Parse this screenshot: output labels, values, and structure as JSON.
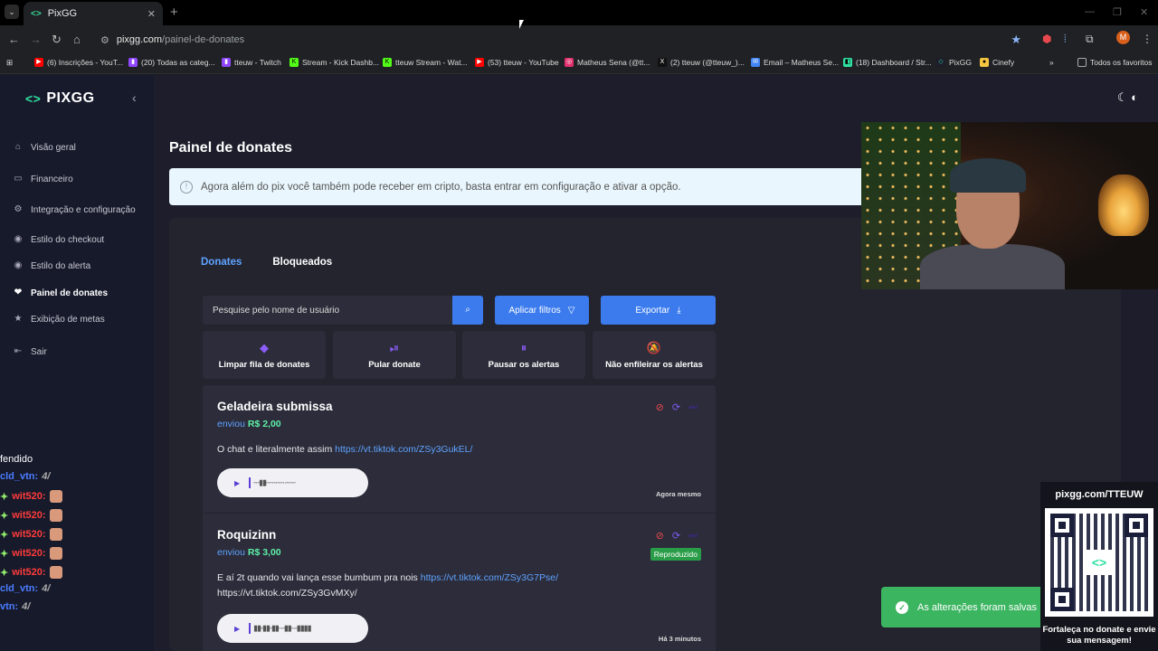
{
  "browser": {
    "tab_title": "PixGG",
    "tab_favicon": "<>",
    "url_host": "pixgg.com",
    "url_path": "/painel-de-donates",
    "bookmarks": [
      {
        "label": "(6) Inscrições - YouT...",
        "icon": "youtube-icon",
        "color": "#ff0000"
      },
      {
        "label": "(20) Todas as categ...",
        "icon": "twitch-icon",
        "color": "#9146ff"
      },
      {
        "label": "tteuw - Twitch",
        "icon": "twitch-icon",
        "color": "#9146ff"
      },
      {
        "label": "Stream - Kick Dashb...",
        "icon": "kick-icon",
        "color": "#53fc18"
      },
      {
        "label": "tteuw Stream - Wat...",
        "icon": "kick-icon",
        "color": "#53fc18"
      },
      {
        "label": "(53) tteuw - YouTube",
        "icon": "youtube-icon",
        "color": "#ff0000"
      },
      {
        "label": "Matheus Sena (@tt...",
        "icon": "instagram-icon",
        "color": "#e1306c"
      },
      {
        "label": "(2) tteuw (@tteuw_)...",
        "icon": "x-icon",
        "color": "#000000"
      },
      {
        "label": "Email – Matheus Se...",
        "icon": "email-icon",
        "color": "#4285f4"
      },
      {
        "label": "(18) Dashboard / Str...",
        "icon": "dashboard-icon",
        "color": "#2fe0a0"
      },
      {
        "label": "PixGG",
        "icon": "pixgg-icon",
        "color": "#2fe0a0"
      },
      {
        "label": "Cinefy",
        "icon": "cinefy-icon",
        "color": "#f5c542"
      }
    ],
    "all_bookmarks": "Todos os favoritos",
    "profile_initial": "M"
  },
  "sidebar": {
    "logo": "PIXGG",
    "items": [
      {
        "label": "Visão geral",
        "icon": "home-icon"
      },
      {
        "label": "Financeiro",
        "icon": "wallet-icon"
      },
      {
        "label": "Integração e configuração",
        "icon": "settings-icon"
      },
      {
        "label": "Estilo do checkout",
        "icon": "palette-icon"
      },
      {
        "label": "Estilo do alerta",
        "icon": "palette-icon"
      },
      {
        "label": "Painel de donates",
        "icon": "donate-icon"
      },
      {
        "label": "Exibição de metas",
        "icon": "star-icon"
      },
      {
        "label": "Sair",
        "icon": "logout-icon"
      }
    ]
  },
  "chat": {
    "lines": [
      {
        "user": "fendido",
        "msg": "",
        "color": "#ffffff"
      },
      {
        "user": "cld_vtn:",
        "msg": "4/",
        "color": "#4a7cff"
      },
      {
        "user": "wit520:",
        "msg": "",
        "color": "#ff3b3b"
      },
      {
        "user": "wit520:",
        "msg": "",
        "color": "#ff3b3b"
      },
      {
        "user": "wit520:",
        "msg": "",
        "color": "#ff3b3b"
      },
      {
        "user": "wit520:",
        "msg": "",
        "color": "#ff3b3b"
      },
      {
        "user": "wit520:",
        "msg": "",
        "color": "#ff3b3b"
      },
      {
        "user": "cld_vtn:",
        "msg": "4/",
        "color": "#4a7cff"
      },
      {
        "user": "vtn:",
        "msg": "4/",
        "color": "#4a7cff"
      }
    ]
  },
  "main": {
    "page_title": "Painel de donates",
    "info": "Agora além do pix você também pode receber em cripto, basta entrar em configuração e ativar a opção.",
    "tabs": [
      {
        "label": "Donates",
        "active": true
      },
      {
        "label": "Bloqueados",
        "active": false
      }
    ],
    "search_placeholder": "Pesquise pelo nome de usuário",
    "filter_label": "Aplicar filtros",
    "export_label": "Exportar",
    "actions": [
      {
        "label": "Limpar fila de donates",
        "icon": "eraser-icon"
      },
      {
        "label": "Pular donate",
        "icon": "skip-icon"
      },
      {
        "label": "Pausar os alertas",
        "icon": "pause-icon"
      },
      {
        "label": "Não enfileirar os alertas",
        "icon": "bell-off-icon"
      }
    ],
    "donates": [
      {
        "name": "Geladeira submissa",
        "sent_label": "enviou",
        "amount": "R$ 2,00",
        "message": "O chat e literalmente assim ",
        "link": "https://vt.tiktok.com/ZSy3GukEL/",
        "message_after": "",
        "time": "Agora mesmo",
        "badge": ""
      },
      {
        "name": "Roquizinn",
        "sent_label": "enviou",
        "amount": "R$ 3,00",
        "message": "E aí 2t quando vai lança esse bumbum pra nois ",
        "link": "https://vt.tiktok.com/ZSy3G7Pse/",
        "message_after": "https://vt.tiktok.com/ZSy3GvMXy/",
        "time": "Há 3 minutos",
        "badge": "Reproduzido"
      }
    ]
  },
  "toast": "As alterações foram salvas",
  "qr_widget": {
    "url": "pixgg.com/TTEUW",
    "cta": "Fortaleça no donate e envie sua mensagem!"
  }
}
